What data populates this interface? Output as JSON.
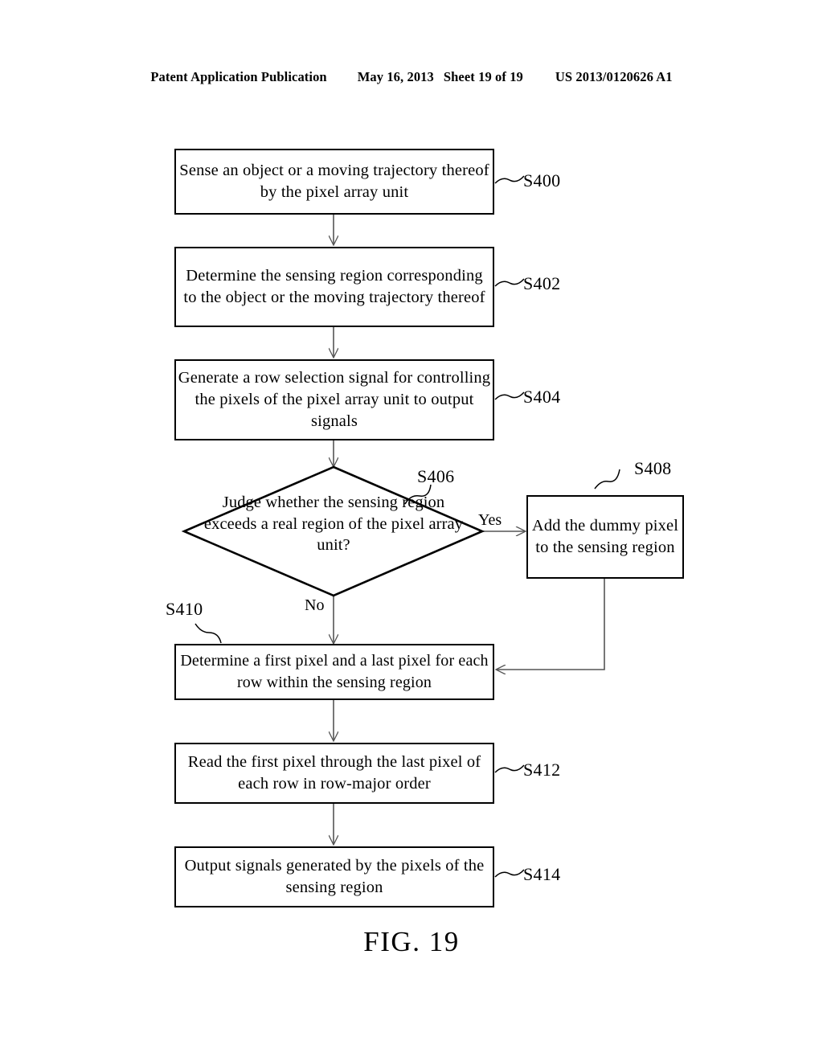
{
  "header": {
    "publication": "Patent Application Publication",
    "date": "May 16, 2013",
    "sheet": "Sheet 19 of 19",
    "number": "US 2013/0120626 A1"
  },
  "figure": {
    "caption": "FIG. 19"
  },
  "flowchart": {
    "branch_yes": "Yes",
    "branch_no": "No",
    "steps": [
      {
        "id": "S400",
        "ref": "S400",
        "shape": "process",
        "text": "Sense an object or a moving trajectory thereof by the pixel array unit"
      },
      {
        "id": "S402",
        "ref": "S402",
        "shape": "process",
        "text": "Determine the sensing region corresponding to the object or the moving trajectory thereof"
      },
      {
        "id": "S404",
        "ref": "S404",
        "shape": "process",
        "text": "Generate a row selection signal for controlling the pixels of the pixel array unit to output signals"
      },
      {
        "id": "S406",
        "ref": "S406",
        "shape": "decision",
        "text": "Judge whether the sensing region exceeds a real region of the pixel array unit?"
      },
      {
        "id": "S408",
        "ref": "S408",
        "shape": "process",
        "text": "Add the dummy pixel to the sensing region"
      },
      {
        "id": "S410",
        "ref": "S410",
        "shape": "process",
        "text": "Determine a first pixel and a last pixel for each row within the sensing region"
      },
      {
        "id": "S412",
        "ref": "S412",
        "shape": "process",
        "text": "Read the first pixel through the last pixel of each row in row-major order"
      },
      {
        "id": "S414",
        "ref": "S414",
        "shape": "process",
        "text": "Output signals generated by the pixels of the sensing region"
      }
    ]
  },
  "colors": {
    "ink": "#000000",
    "paper": "#ffffff",
    "connector": "#555555"
  }
}
